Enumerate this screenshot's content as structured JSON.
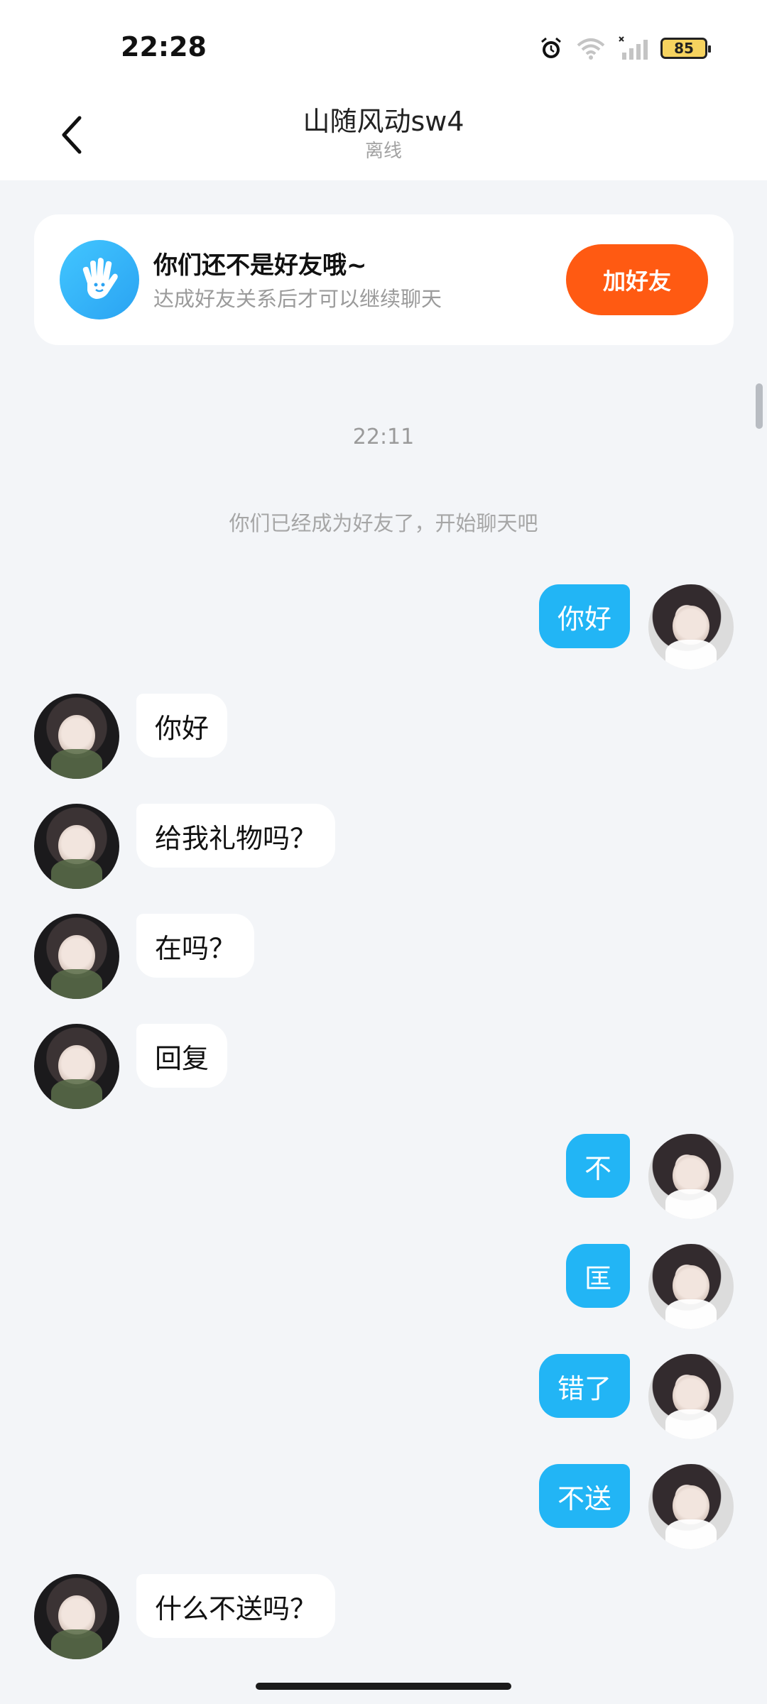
{
  "status_bar": {
    "time": "22:28",
    "battery": "85"
  },
  "header": {
    "title": "山随风动sw4",
    "status": "离线",
    "back_icon": "chevron-left-icon"
  },
  "friend_card": {
    "title": "你们还不是好友哦~",
    "subtitle": "达成好友关系后才可以继续聊天",
    "button": "加好友",
    "icon": "hand-wave-icon",
    "accent": "#ff5a12"
  },
  "chat": {
    "timestamp": "22:11",
    "system_message": "你们已经成为好友了，开始聊天吧",
    "messages": [
      {
        "side": "right",
        "text": "你好"
      },
      {
        "side": "left",
        "text": "你好"
      },
      {
        "side": "left",
        "text": "给我礼物吗？"
      },
      {
        "side": "left",
        "text": "在吗？"
      },
      {
        "side": "left",
        "text": "回复"
      },
      {
        "side": "right",
        "text": "不"
      },
      {
        "side": "right",
        "text": "匡"
      },
      {
        "side": "right",
        "text": "错了"
      },
      {
        "side": "right",
        "text": "不送"
      },
      {
        "side": "left",
        "text": "什么不送吗？"
      }
    ]
  },
  "colors": {
    "bubble_right": "#22b5f5",
    "bubble_left": "#ffffff",
    "background": "#f3f5f8"
  }
}
